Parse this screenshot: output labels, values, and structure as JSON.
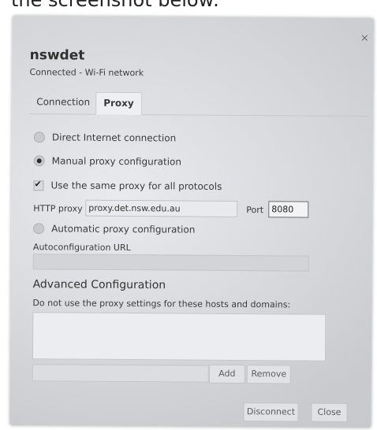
{
  "caption": "the screenshot below:",
  "window": {
    "close_glyph": "×"
  },
  "network": {
    "name": "nswdet",
    "status": "Connected - Wi-Fi network"
  },
  "tabs": [
    {
      "label": "Connection",
      "active": false
    },
    {
      "label": "Proxy",
      "active": true
    }
  ],
  "proxy": {
    "direct_label": "Direct Internet connection",
    "manual_label": "Manual proxy configuration",
    "same_proxy_label": "Use the same proxy for all protocols",
    "same_proxy_checked": true,
    "selected_mode": "manual",
    "http_label": "HTTP proxy",
    "http_value": "proxy.det.nsw.edu.au",
    "port_label": "Port",
    "port_value": "8080",
    "auto_label": "Automatic proxy configuration",
    "auto_url_label": "Autoconfiguration URL",
    "auto_url_value": ""
  },
  "advanced": {
    "title": "Advanced Configuration",
    "description": "Do not use the proxy settings for these hosts and domains:",
    "new_host_value": "",
    "add_label": "Add",
    "remove_label": "Remove"
  },
  "footer": {
    "disconnect_label": "Disconnect",
    "close_label": "Close"
  }
}
